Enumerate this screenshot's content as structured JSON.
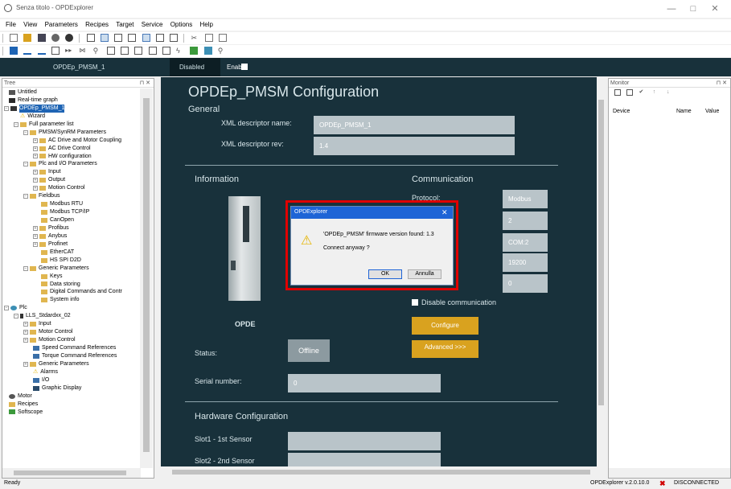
{
  "window": {
    "title": "Senza titolo - OPDExplorer",
    "minimize": "—",
    "maximize": "□",
    "close": "✕"
  },
  "menu": [
    "File",
    "View",
    "Parameters",
    "Recipes",
    "Target",
    "Service",
    "Options",
    "Help"
  ],
  "devicebar": {
    "device_name": "OPDEp_PMSM_1",
    "state": "Disabled",
    "enable_label": "Enable"
  },
  "tree": {
    "title": "Tree",
    "pin": "⊓ ✕",
    "items": [
      "Untitled",
      "Real-time graph",
      "OPDEp_PMSM_1",
      "Wizard",
      "Full parameter list",
      "PMSM/SynRM Parameters",
      "AC Drive and Motor Coupling",
      "AC Drive Control",
      "HW configuration",
      "Plc and I/O Parameters",
      "Input",
      "Output",
      "Motion Control",
      "Fieldbus",
      "Modbus RTU",
      "Modbus TCP/IP",
      "CanOpen",
      "Profibus",
      "Anybus",
      "Profinet",
      "EtherCAT",
      "HS SPI D2D",
      "Generic Parameters",
      "Keys",
      "Data storing",
      "Digital Commands and Contr",
      "System info",
      "Plc",
      "LLS_Stdardxx_02",
      "Input",
      "Motor Control",
      "Motion Control",
      "Speed Command References",
      "Torque Command References",
      "Generic Parameters",
      "Alarms",
      "I/O",
      "Graphic Display",
      "Motor",
      "Recipes",
      "Softscope"
    ]
  },
  "config": {
    "title": "OPDEp_PMSM Configuration",
    "general": "General",
    "xml_name_label": "XML descriptor name:",
    "xml_name_value": "OPDEp_PMSM_1",
    "xml_rev_label": "XML descriptor rev:",
    "xml_rev_value": "1.4",
    "information": "Information",
    "communication": "Communication",
    "protocol_label": "Protocol:",
    "protocol_value": "Modbus",
    "address_value": "2",
    "port_value": "COM:2",
    "baud_value": "19200",
    "timeout_value": "0",
    "disable_comm": "Disable communication",
    "configure": "Configure",
    "advanced": "Advanced >>>",
    "device_caption": "OPDE",
    "status_label": "Status:",
    "status_value": "Offline",
    "serial_label": "Serial number:",
    "serial_value": "0",
    "hw_config": "Hardware Configuration",
    "slot1_label": "Slot1 - 1st Sensor",
    "slot2_label": "Slot2 - 2nd Sensor"
  },
  "monitor": {
    "title": "Monitor",
    "pin": "⊓ ✕",
    "col_device": "Device",
    "col_name": "Name",
    "col_value": "Value"
  },
  "dialog": {
    "title": "OPDExplorer",
    "close": "✕",
    "message": "'OPDEp_PMSM' firmware version found: 1.3",
    "question": "Connect anyway ?",
    "ok": "OK",
    "cancel": "Annulla"
  },
  "statusbar": {
    "left": "Ready",
    "version": "OPDExplorer v.2.0.10.0",
    "conn": "DISCONNECTED"
  }
}
